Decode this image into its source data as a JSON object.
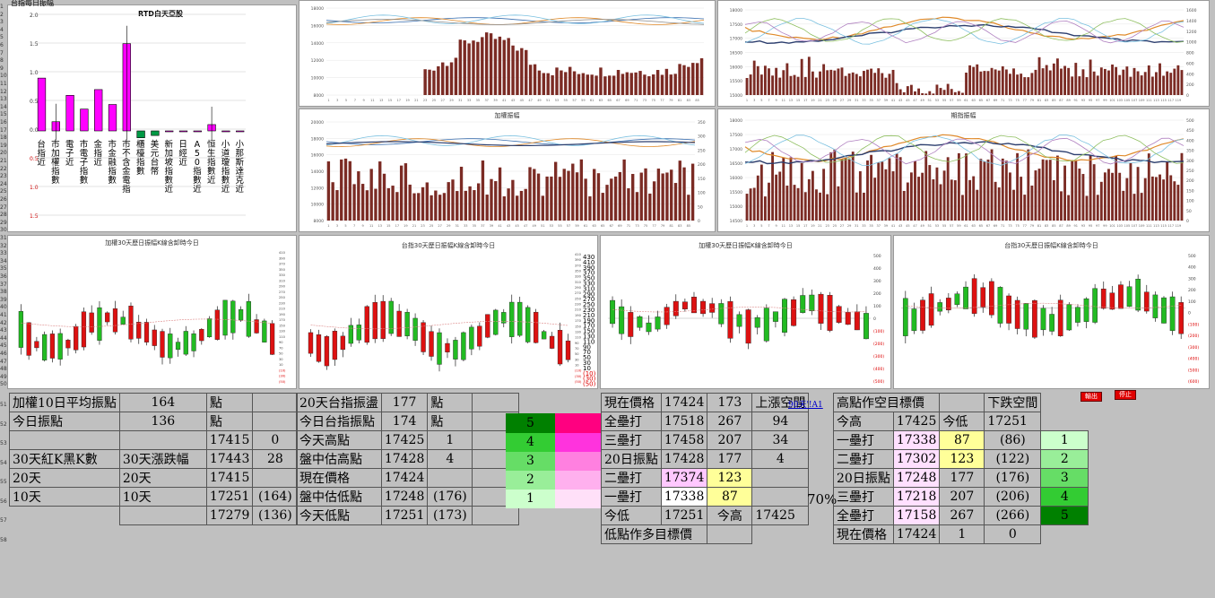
{
  "sheet_title": "台指每日振幅",
  "top_left_chart": {
    "title": "RTD白天亞股",
    "yticks": [
      "2.0",
      "1.5",
      "1.0",
      "0.5",
      "0.0",
      "0.5",
      "1.0",
      "1.5"
    ],
    "categories": [
      "台指近",
      "市加權指數",
      "電子近",
      "市電子指數",
      "金指近",
      "市金融指數",
      "市不含金電指",
      "櫃檯指數",
      "美元台幣",
      "新加坡指數近",
      "日經近",
      "A50指數近",
      "恒生指數近",
      "小道瓊指數近",
      "小那斯達克近"
    ],
    "values": [
      0.92,
      0.16,
      0.62,
      0.38,
      0.72,
      0.46,
      1.52,
      -0.12,
      -0.08,
      0,
      0,
      0,
      0.11,
      0,
      0
    ]
  },
  "chart_titles": {
    "mid_top_2": "加權振幅",
    "right_top_2": "期指振幅",
    "row2_1": "加權30天歷日振幅K線含卸時今日",
    "row2_2": "台指30天歷日振幅K線含卸時今日",
    "row2_3": "加權30天歷日振幅K線含卸時今日",
    "row2_4": "台指30天歷日振幅K線含卸時今日"
  },
  "chart_axes": {
    "mid_top_left": [
      "18000",
      "16000",
      "14000",
      "12000",
      "10000",
      "8000"
    ],
    "mid_bot_left": [
      "20000",
      "18000",
      "16000",
      "14000",
      "12000",
      "10000",
      "8000"
    ],
    "mid_bot_right": [
      "350",
      "300",
      "250",
      "200",
      "150",
      "100",
      "50",
      "0"
    ],
    "rt_left": [
      "18000",
      "17500",
      "17000",
      "16500",
      "16000",
      "15500",
      "15000"
    ],
    "rt_right": [
      "1600",
      "1400",
      "1200",
      "1000",
      "800",
      "600",
      "400",
      "200",
      "0"
    ],
    "rb_left": [
      "18000",
      "17500",
      "17000",
      "16500",
      "16000",
      "15500",
      "15000",
      "14500"
    ],
    "rb_right": [
      "500",
      "450",
      "400",
      "350",
      "300",
      "250",
      "200",
      "150",
      "100",
      "50",
      "0"
    ],
    "c3_ticks": [
      "500",
      "400",
      "300",
      "200",
      "100",
      "0",
      "(100)",
      "(200)",
      "(300)",
      "(400)",
      "(500)"
    ],
    "c4_ticks": [
      "500",
      "400",
      "300",
      "200",
      "100",
      "0",
      "(100)",
      "(200)",
      "(300)",
      "(400)",
      "(500)",
      "(600)"
    ]
  },
  "buttons": {
    "b1": "輸出",
    "b2": "停止"
  },
  "link_text": "90天'!A1",
  "pct_label": "70%",
  "t1": [
    [
      "加權10日平均振點",
      "164",
      "點",
      "",
      "",
      ""
    ],
    [
      "今日振點",
      "136",
      "點",
      "",
      "",
      ""
    ],
    [
      "",
      "",
      "17415",
      "0",
      "",
      ""
    ],
    [
      "30天紅K黑K數",
      "30天漲跌幅",
      "17443",
      "28",
      "",
      ""
    ],
    [
      "20天",
      "20天",
      "17415",
      "",
      "",
      ""
    ],
    [
      "10天",
      "10天",
      "17251",
      "(164)",
      "",
      ""
    ],
    [
      "",
      "",
      "17279",
      "(136)",
      "",
      ""
    ]
  ],
  "t2": [
    [
      "20天台指振盪",
      "177",
      "點",
      ""
    ],
    [
      "今日台指振點",
      "174",
      "點",
      ""
    ],
    [
      "今天高點",
      "17425",
      "1",
      ""
    ],
    [
      "盤中估高點",
      "17428",
      "4",
      ""
    ],
    [
      "現在價格",
      "17424",
      "",
      ""
    ],
    [
      "盤中估低點",
      "17248",
      "(176)",
      ""
    ],
    [
      "今天低點",
      "17251",
      "(173)",
      ""
    ]
  ],
  "t3": [
    [
      "5",
      ""
    ],
    [
      "4",
      ""
    ],
    [
      "3",
      ""
    ],
    [
      "2",
      ""
    ],
    [
      "1",
      ""
    ]
  ],
  "t4": [
    [
      "現在價格",
      "17424",
      "173",
      "上漲空間"
    ],
    [
      "全壘打",
      "17518",
      "267",
      "94"
    ],
    [
      "三壘打",
      "17458",
      "207",
      "34"
    ],
    [
      "20日振點",
      "17428",
      "177",
      "4"
    ],
    [
      "二壘打",
      "17374",
      "123",
      ""
    ],
    [
      "一壘打",
      "17338",
      "87",
      ""
    ],
    [
      "今低",
      "17251",
      "今高",
      "17425"
    ],
    [
      "低點作多目標價",
      "",
      "",
      ""
    ]
  ],
  "t5": [
    [
      "高點作空目標價",
      "",
      "",
      "下跌空間",
      ""
    ],
    [
      "今高",
      "17425",
      "今低",
      "17251",
      ""
    ],
    [
      "一壘打",
      "17338",
      "87",
      "(86)",
      "1"
    ],
    [
      "二壘打",
      "17302",
      "123",
      "(122)",
      "2"
    ],
    [
      "20日振點",
      "17248",
      "177",
      "(176)",
      "3"
    ],
    [
      "三壘打",
      "17218",
      "207",
      "(206)",
      "4"
    ],
    [
      "全壘打",
      "17158",
      "267",
      "(266)",
      "5"
    ],
    [
      "現在價格",
      "17424",
      "1",
      "0",
      ""
    ]
  ]
}
